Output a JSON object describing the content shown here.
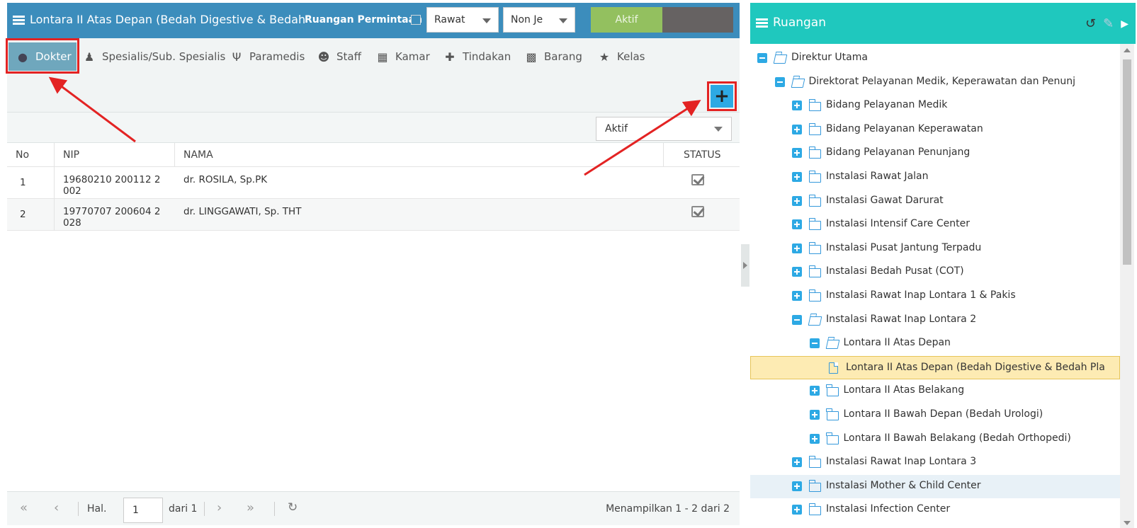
{
  "left_header": {
    "title": "Lontara II Atas Depan (Bedah Digestive & Bedah Pla",
    "ruangan_permintaan_label": "Ruangan Permintaan",
    "rawat_select": "Rawat",
    "jenis_select": "Non Je",
    "aktif_button": "Aktif"
  },
  "tabs": [
    {
      "label": "Dokter",
      "icon": "doctor-icon"
    },
    {
      "label": "Spesialis/Sub. Spesialis",
      "icon": "specialist-icon"
    },
    {
      "label": "Paramedis",
      "icon": "stethoscope-icon"
    },
    {
      "label": "Staff",
      "icon": "user-icon"
    },
    {
      "label": "Kamar",
      "icon": "building-icon"
    },
    {
      "label": "Tindakan",
      "icon": "medkit-icon"
    },
    {
      "label": "Barang",
      "icon": "cubes-icon"
    },
    {
      "label": "Kelas",
      "icon": "star-icon"
    }
  ],
  "filter": {
    "status_select": "Aktif"
  },
  "table": {
    "columns": [
      "No",
      "NIP",
      "NAMA",
      "STATUS"
    ],
    "rows": [
      {
        "no": "1",
        "nip": "19680210 200112 2 002",
        "nama": "dr. ROSILA, Sp.PK",
        "status": true
      },
      {
        "no": "2",
        "nip": "19770707 200604 2 028",
        "nama": "dr. LINGGAWATI, Sp. THT",
        "status": true
      }
    ]
  },
  "pager": {
    "hal_label": "Hal.",
    "page": "1",
    "of_label": "dari 1",
    "info": "Menampilkan 1 - 2 dari 2"
  },
  "right_header": {
    "title": "Ruangan"
  },
  "tree": [
    {
      "label": "Direktur Utama",
      "level": 0,
      "expanded": true,
      "type": "folder"
    },
    {
      "label": "Direktorat Pelayanan Medik, Keperawatan dan Penunj",
      "level": 1,
      "expanded": true,
      "type": "folder"
    },
    {
      "label": "Bidang Pelayanan Medik",
      "level": 2,
      "expanded": false,
      "type": "folder"
    },
    {
      "label": "Bidang Pelayanan Keperawatan",
      "level": 2,
      "expanded": false,
      "type": "folder"
    },
    {
      "label": "Bidang Pelayanan Penunjang",
      "level": 2,
      "expanded": false,
      "type": "folder"
    },
    {
      "label": "Instalasi Rawat Jalan",
      "level": 2,
      "expanded": false,
      "type": "folder"
    },
    {
      "label": "Instalasi Gawat Darurat",
      "level": 2,
      "expanded": false,
      "type": "folder"
    },
    {
      "label": "Instalasi Intensif Care Center",
      "level": 2,
      "expanded": false,
      "type": "folder"
    },
    {
      "label": "Instalasi Pusat Jantung Terpadu",
      "level": 2,
      "expanded": false,
      "type": "folder"
    },
    {
      "label": "Instalasi Bedah Pusat (COT)",
      "level": 2,
      "expanded": false,
      "type": "folder"
    },
    {
      "label": "Instalasi Rawat Inap Lontara 1 & Pakis",
      "level": 2,
      "expanded": false,
      "type": "folder"
    },
    {
      "label": "Instalasi Rawat Inap Lontara 2",
      "level": 2,
      "expanded": true,
      "type": "folder"
    },
    {
      "label": "Lontara II Atas Depan",
      "level": 3,
      "expanded": true,
      "type": "folder"
    },
    {
      "label": "Lontara II Atas Depan (Bedah Digestive & Bedah Pla",
      "level": 4,
      "type": "file",
      "selected": true
    },
    {
      "label": "Lontara II Atas Belakang",
      "level": 3,
      "expanded": false,
      "type": "folder"
    },
    {
      "label": "Lontara II Bawah Depan (Bedah Urologi)",
      "level": 3,
      "expanded": false,
      "type": "folder"
    },
    {
      "label": "Lontara II Bawah Belakang (Bedah Orthopedi)",
      "level": 3,
      "expanded": false,
      "type": "folder"
    },
    {
      "label": "Instalasi Rawat Inap Lontara 3",
      "level": 2,
      "expanded": false,
      "type": "folder"
    },
    {
      "label": "Instalasi Mother & Child Center",
      "level": 2,
      "expanded": false,
      "type": "folder",
      "hover": true
    },
    {
      "label": "Instalasi Infection Center",
      "level": 2,
      "expanded": false,
      "type": "folder"
    }
  ],
  "colors": {
    "left_header": "#3c8dbc",
    "right_header": "#1fc8be",
    "aktif_green": "#93c05f",
    "active_tab": "#6fa7bd",
    "add_button": "#2da9e4",
    "highlight_red": "#e32323",
    "selected_node": "#fdebb3"
  }
}
